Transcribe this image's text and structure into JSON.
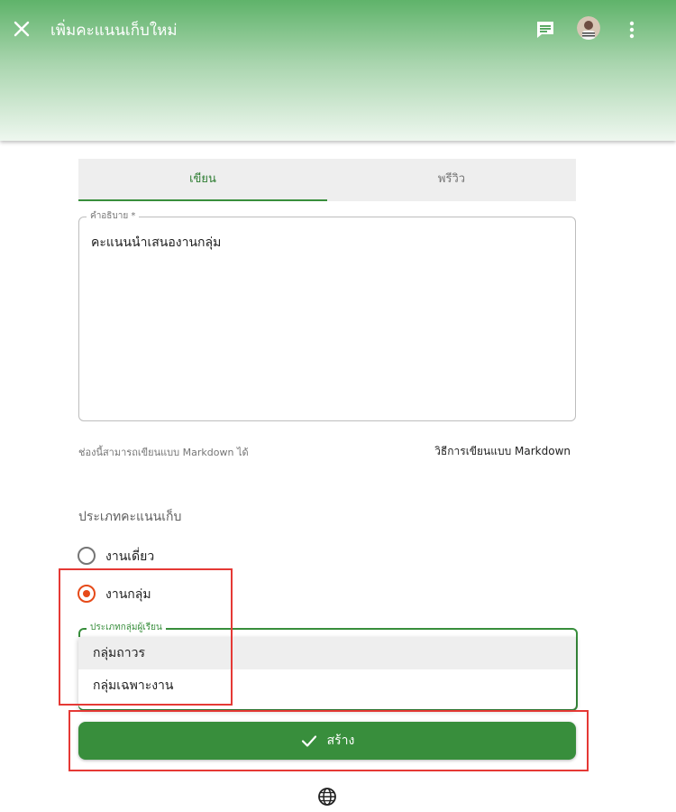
{
  "header": {
    "title": "เพิ่มคะแนนเก็บใหม่",
    "icons": {
      "close": "close-icon",
      "chat": "chat-icon",
      "more": "more-vert-icon"
    },
    "gradient_colors": [
      "#5fb36a",
      "#eef7ef"
    ]
  },
  "tabs": {
    "write": "เขียน",
    "preview": "พรีวิว",
    "active": "write"
  },
  "description": {
    "label": "คำอธิบาย *",
    "value": "คะแนนนำเสนองานกลุ่ม"
  },
  "markdown": {
    "hint": "ช่องนี้สามารถเขียนแบบ Markdown ได้",
    "link": "วิธีการเขียนแบบ Markdown"
  },
  "score_type": {
    "label": "ประเภทคะแนนเก็บ",
    "options": [
      {
        "label": "งานเดี่ยว",
        "checked": false
      },
      {
        "label": "งานกลุ่ม",
        "checked": true
      }
    ]
  },
  "group_type": {
    "label": "ประเภทกลุ่มผู้เรียน",
    "options": [
      "กลุ่มถาวร",
      "กลุ่มเฉพาะงาน"
    ],
    "highlighted": "กลุ่มถาวร"
  },
  "create_button": {
    "label": "สร้าง",
    "icon": "check-icon"
  },
  "footer": {
    "icon": "globe-icon"
  },
  "colors": {
    "primary": "#388e3c",
    "radio_checked": "#e64a19",
    "annotation": "#e53935"
  }
}
